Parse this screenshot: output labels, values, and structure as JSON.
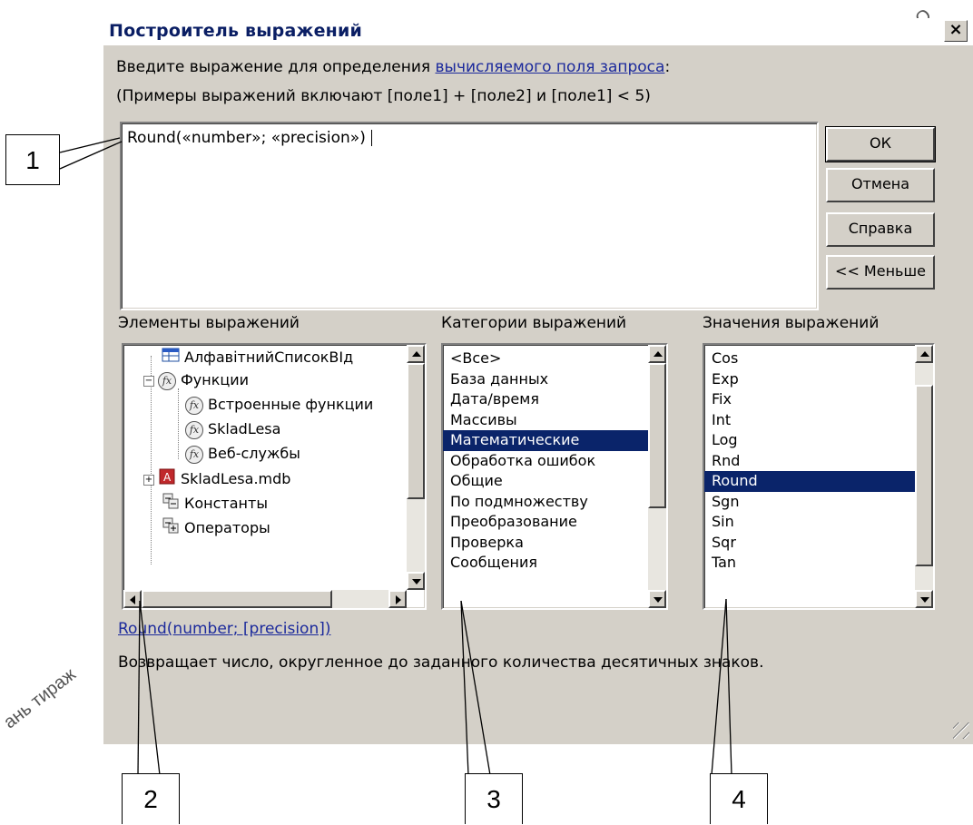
{
  "dialog": {
    "title": "Построитель выражений",
    "close_label": "×",
    "prompt_text": "Введите выражение для определения",
    "prompt_link": "вычисляемого поля запроса",
    "prompt_suffix": ":",
    "examples": "(Примеры выражений включают [поле1] + [поле2] и [поле1] < 5)",
    "expression": "Round(«number»; «precision»)",
    "buttons": {
      "ok": "ОК",
      "cancel": "Отмена",
      "help": "Справка",
      "less": "<< Меньше"
    },
    "elements": {
      "label": "Элементы выражений",
      "items": [
        {
          "label": "АлфавітнийСписокВІд",
          "icon": "query-table-icon"
        },
        {
          "label": "Функции",
          "icon": "function-icon",
          "expander": "−"
        },
        {
          "label": "Встроенные функции",
          "icon": "function-icon"
        },
        {
          "label": "SkladLesa",
          "icon": "function-icon"
        },
        {
          "label": "Веб-службы",
          "icon": "function-icon"
        },
        {
          "label": "SkladLesa.mdb",
          "icon": "database-icon",
          "expander": "+"
        },
        {
          "label": "Константы",
          "icon": "constants-icon"
        },
        {
          "label": "Операторы",
          "icon": "operators-icon"
        }
      ]
    },
    "categories": {
      "label": "Категории выражений",
      "items": [
        "<Все>",
        "База данных",
        "Дата/время",
        "Массивы",
        "Математические",
        "Обработка ошибок",
        "Общие",
        "По подмножеству",
        "Преобразование",
        "Проверка",
        "Сообщения"
      ],
      "selected": "Математические"
    },
    "values": {
      "label": "Значения выражений",
      "items": [
        "Cos",
        "Exp",
        "Fix",
        "Int",
        "Log",
        "Rnd",
        "Round",
        "Sgn",
        "Sin",
        "Sqr",
        "Tan"
      ],
      "selected": "Round"
    },
    "syntax": "Round(number; [precision])",
    "description": "Возвращает число, округленное до заданного количества десятичных знаков."
  },
  "callouts": [
    "1",
    "2",
    "3",
    "4"
  ],
  "watermark": {
    "left": "ань тираж",
    "right": "О"
  }
}
